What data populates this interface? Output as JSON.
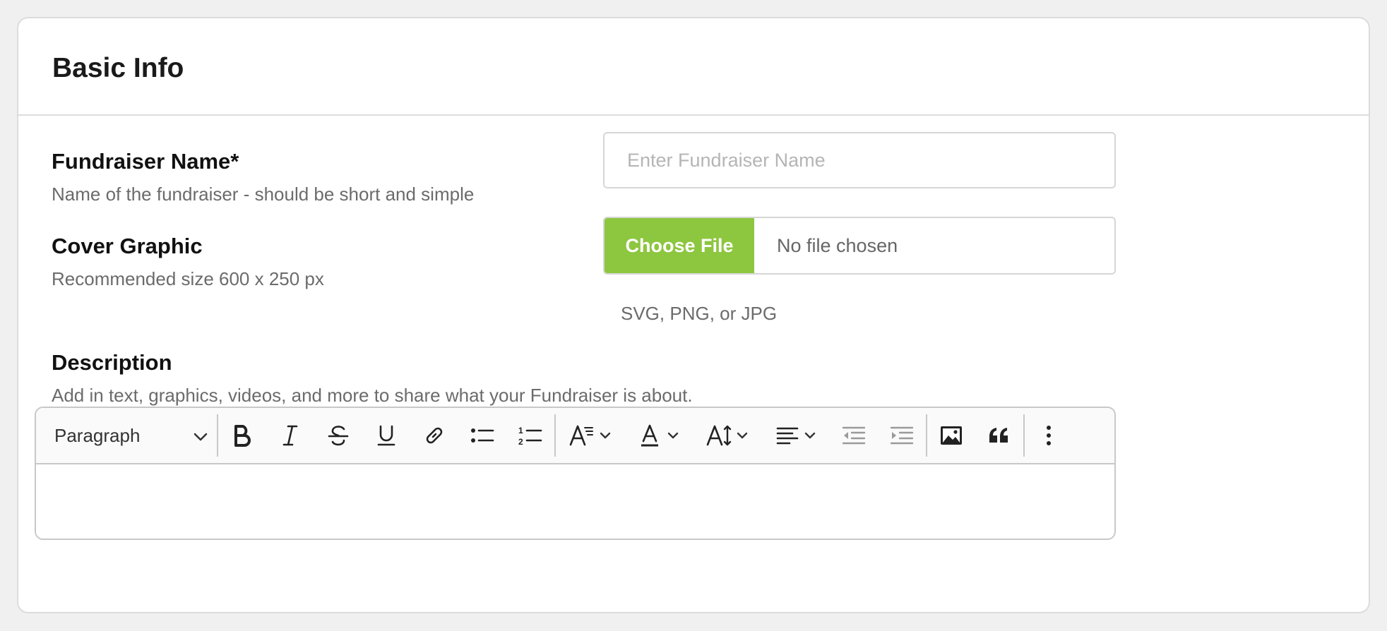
{
  "card": {
    "title": "Basic Info"
  },
  "fundraiser_name": {
    "label": "Fundraiser Name*",
    "hint": "Name of the fundraiser - should be short and simple",
    "placeholder": "Enter Fundraiser Name",
    "value": ""
  },
  "cover_graphic": {
    "label": "Cover Graphic",
    "hint": "Recommended size 600 x 250 px",
    "button_label": "Choose File",
    "status": "No file chosen",
    "formats": "SVG, PNG, or JPG"
  },
  "description": {
    "label": "Description",
    "hint": "Add in text, graphics, videos, and more to share what your Fundraiser is about.",
    "toolbar": {
      "block_format": "Paragraph",
      "icons": [
        "bold-icon",
        "italic-icon",
        "strikethrough-icon",
        "underline-icon",
        "link-icon",
        "bulleted-list-icon",
        "numbered-list-icon",
        "font-family-icon",
        "font-color-icon",
        "font-size-icon",
        "align-left-icon",
        "outdent-icon",
        "indent-icon",
        "image-icon",
        "quote-icon",
        "more-icon"
      ]
    },
    "content": ""
  },
  "colors": {
    "accent": "#8dc63f",
    "border": "#dcdcdc",
    "hint_text": "#6b6b6b"
  }
}
